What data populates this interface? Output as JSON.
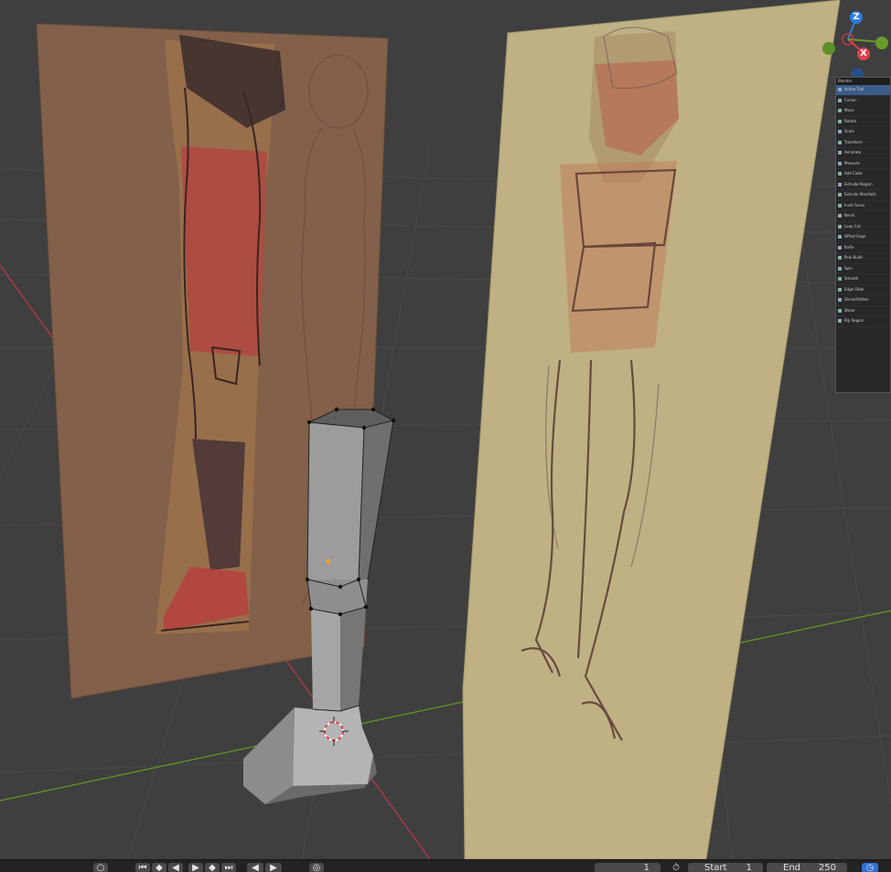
{
  "gizmo": {
    "z_label": "Z",
    "x_label": "X",
    "colors": {
      "z": "#2f7de0",
      "x": "#e0414f",
      "y": "#6b9a2a",
      "center": "#c13a45"
    }
  },
  "mini_panel": {
    "title": "Blender",
    "items": [
      "Active Tool",
      "Cursor",
      "Move",
      "Rotate",
      "Scale",
      "Transform",
      "Annotate",
      "Measure",
      "Add Cube",
      "Extrude Region",
      "Extrude Manifold",
      "Inset Faces",
      "Bevel",
      "Loop Cut",
      "Offset Edge",
      "Knife",
      "Poly Build",
      "Spin",
      "Smooth",
      "Edge Slide",
      "Shrink/Fatten",
      "Shear",
      "Rip Region"
    ]
  },
  "timeline": {
    "current_frame": "1",
    "start_label": "Start",
    "start_value": "1",
    "end_label": "End",
    "end_value": "250",
    "buttons": [
      "jump-start",
      "prev-keyframe",
      "play-reverse",
      "play",
      "next-keyframe",
      "jump-end"
    ]
  }
}
